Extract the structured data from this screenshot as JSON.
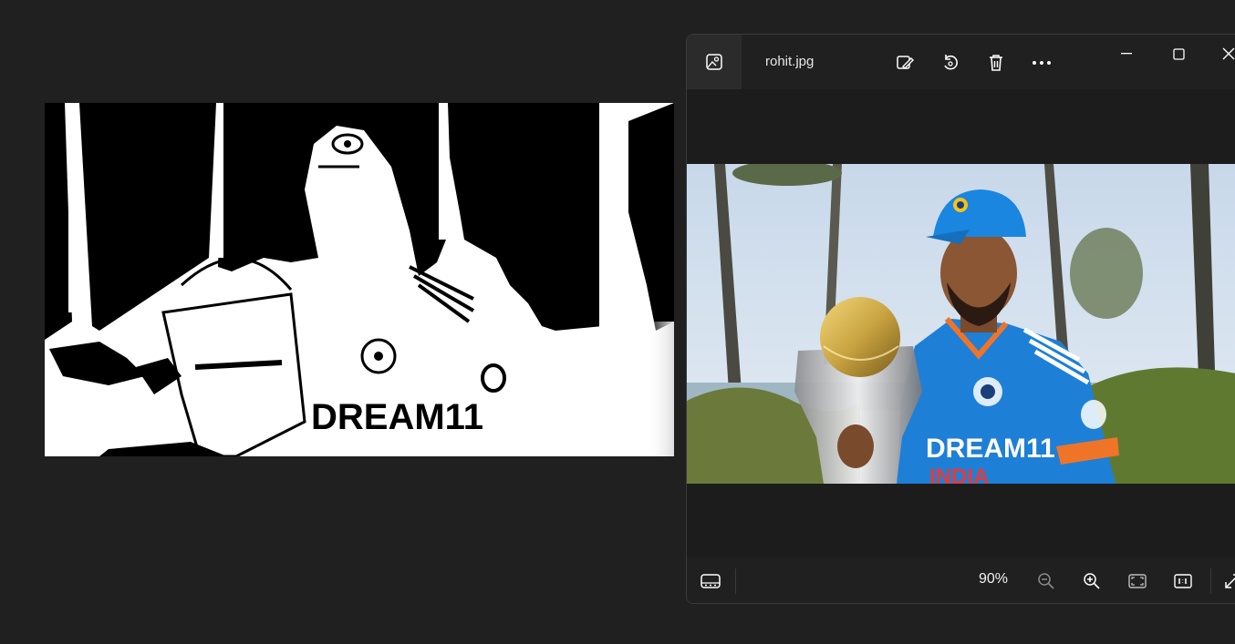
{
  "viewer": {
    "filename": "rohit.jpg",
    "zoom": "90%",
    "photo_jersey_text": "DREAM11",
    "photo_jersey_text2": "INDIA",
    "threshold_jersey_text": "DREAM11"
  },
  "icons": {
    "app": "photo-app-icon",
    "edit": "edit-image-icon",
    "rotate": "rotate-icon",
    "delete": "delete-icon",
    "more": "more-icon",
    "minimize": "minimize-icon",
    "maximize": "maximize-icon",
    "close": "close-icon",
    "filmstrip": "filmstrip-icon",
    "zoom_out": "zoom-out-icon",
    "zoom_in": "zoom-in-icon",
    "fit": "fit-window-icon",
    "actual_size": "actual-size-icon",
    "fullscreen": "fullscreen-icon"
  },
  "colors": {
    "background": "#202020",
    "window": "#1f1f1f",
    "jersey_blue": "#1e7fd6",
    "cap_blue": "#1a86e0",
    "trophy_gold": "#c9a441"
  }
}
